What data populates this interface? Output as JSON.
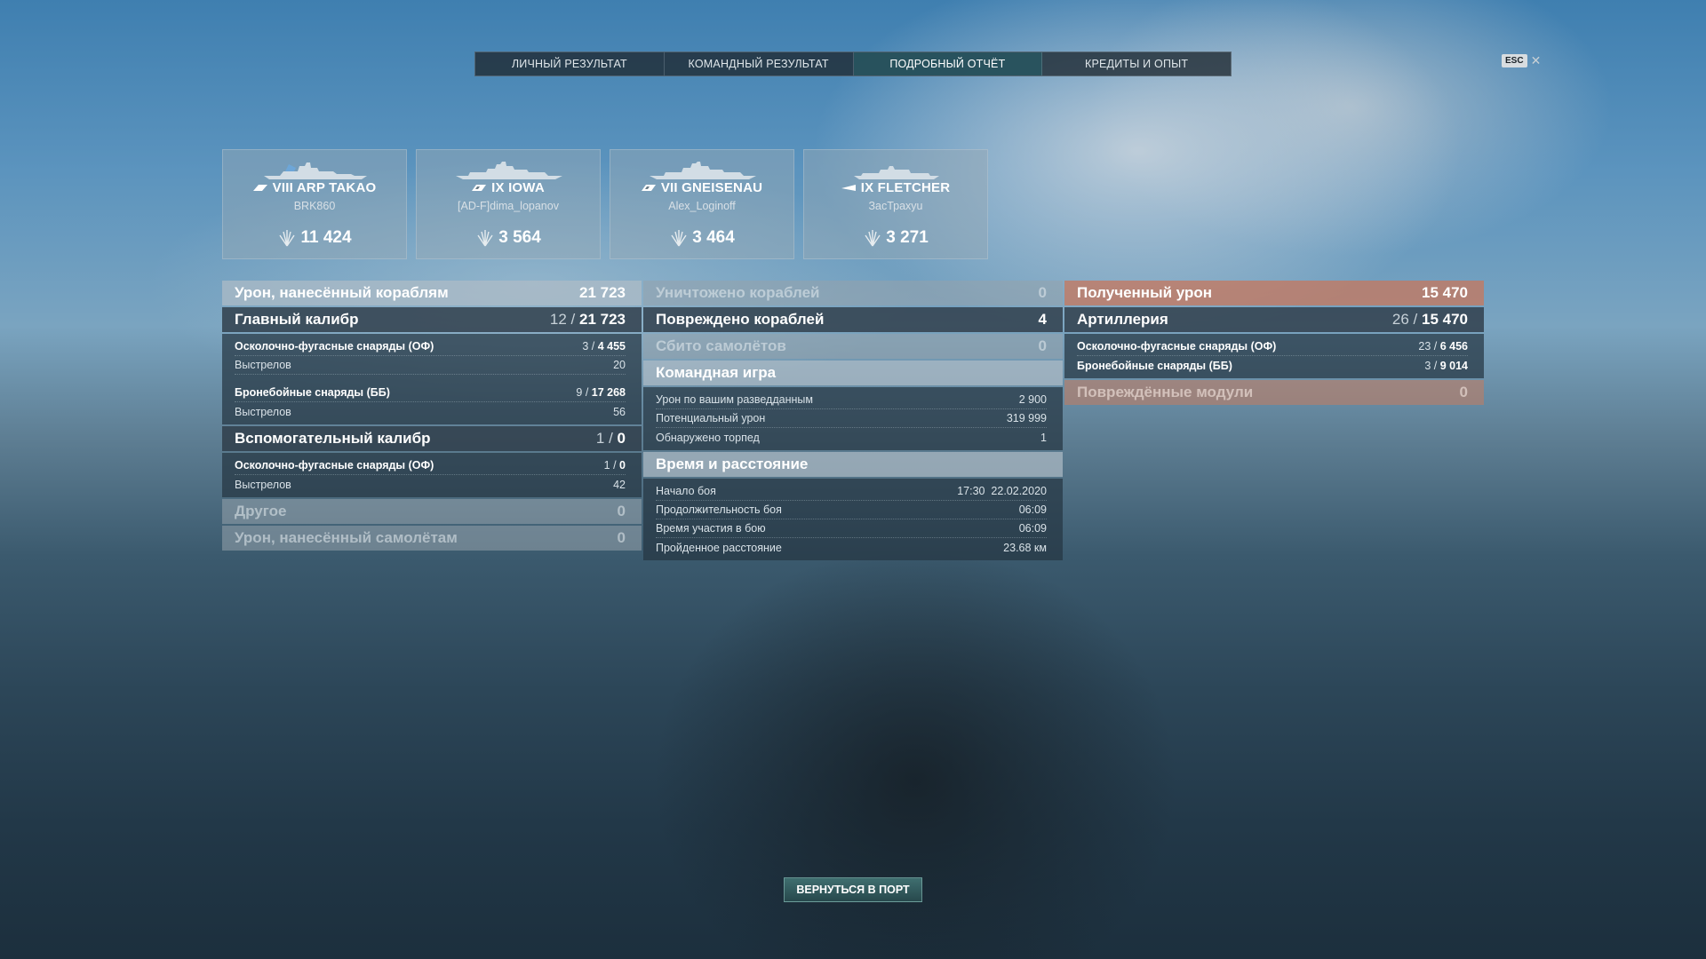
{
  "tabs": [
    {
      "label": "ЛИЧНЫЙ РЕЗУЛЬТАТ"
    },
    {
      "label": "КОМАНДНЫЙ РЕЗУЛЬТАТ"
    },
    {
      "label": "ПОДРОБНЫЙ ОТЧЁТ"
    },
    {
      "label": "КРЕДИТЫ И ОПЫТ"
    }
  ],
  "active_tab": "ПОДРОБНЫЙ ОТЧЁТ",
  "esc_key": "ESC",
  "close_icon": "close-icon",
  "ships": [
    {
      "name": "VIII ARP TAKAO",
      "player": "BRK860",
      "damage": "11 424",
      "class_icon": "cruiser-icon"
    },
    {
      "name": "IX IOWA",
      "player": "[AD-F]dima_lopanov",
      "damage": "3 564",
      "class_icon": "battleship-icon"
    },
    {
      "name": "VII GNEISENAU",
      "player": "Alex_Loginoff",
      "damage": "3 464",
      "class_icon": "battleship-icon"
    },
    {
      "name": "IX FLETCHER",
      "player": "ЗасТрахуu",
      "damage": "3 271",
      "class_icon": "destroyer-icon"
    }
  ],
  "left": {
    "ship_damage": {
      "label": "Урон, нанесённый кораблям",
      "value": "21 723"
    },
    "main_battery": {
      "label": "Главный калибр",
      "hits": "12",
      "value": "21 723"
    },
    "main_he": {
      "label": "Осколочно-фугасные снаряды (ОФ)",
      "hits": "3",
      "value": "4 455"
    },
    "main_he_shots": {
      "label": "Выстрелов",
      "value": "20"
    },
    "main_ap": {
      "label": "Бронебойные снаряды (ББ)",
      "hits": "9",
      "value": "17 268"
    },
    "main_ap_shots": {
      "label": "Выстрелов",
      "value": "56"
    },
    "secondary": {
      "label": "Вспомогательный калибр",
      "hits": "1",
      "value": "0"
    },
    "sec_he": {
      "label": "Осколочно-фугасные снаряды (ОФ)",
      "hits": "1",
      "value": "0"
    },
    "sec_he_shots": {
      "label": "Выстрелов",
      "value": "42"
    },
    "other": {
      "label": "Другое",
      "value": "0"
    },
    "plane_damage": {
      "label": "Урон, нанесённый самолётам",
      "value": "0"
    }
  },
  "middle": {
    "destroyed": {
      "label": "Уничтожено кораблей",
      "value": "0"
    },
    "damaged": {
      "label": "Повреждено кораблей",
      "value": "4"
    },
    "planes": {
      "label": "Сбито самолётов",
      "value": "0"
    },
    "team": {
      "label": "Командная игра"
    },
    "spotting": {
      "label": "Урон по вашим разведданным",
      "value": "2 900"
    },
    "potential": {
      "label": "Потенциальный урон",
      "value": "319 999"
    },
    "torpedoes": {
      "label": "Обнаружено торпед",
      "value": "1"
    },
    "time": {
      "label": "Время и расстояние"
    },
    "start": {
      "label": "Начало боя",
      "value": "17:30  22.02.2020"
    },
    "duration": {
      "label": "Продолжительность боя",
      "value": "06:09"
    },
    "participation": {
      "label": "Время участия в бою",
      "value": "06:09"
    },
    "distance": {
      "label": "Пройденное расстояние",
      "value": "23.68 км"
    }
  },
  "right": {
    "received": {
      "label": "Полученный урон",
      "value": "15 470"
    },
    "artillery": {
      "label": "Артиллерия",
      "hits": "26",
      "value": "15 470"
    },
    "he": {
      "label": "Осколочно-фугасные снаряды (ОФ)",
      "hits": "23",
      "value": "6 456"
    },
    "ap": {
      "label": "Бронебойные снаряды (ББ)",
      "hits": "3",
      "value": "9 014"
    },
    "modules": {
      "label": "Повреждённые модули",
      "value": "0"
    }
  },
  "return_button": "ВЕРНУТЬСЯ В ПОРТ",
  "colors": {
    "active_tab": "#285660",
    "received_header": "#c47860",
    "return_button": "#3f6f70"
  }
}
